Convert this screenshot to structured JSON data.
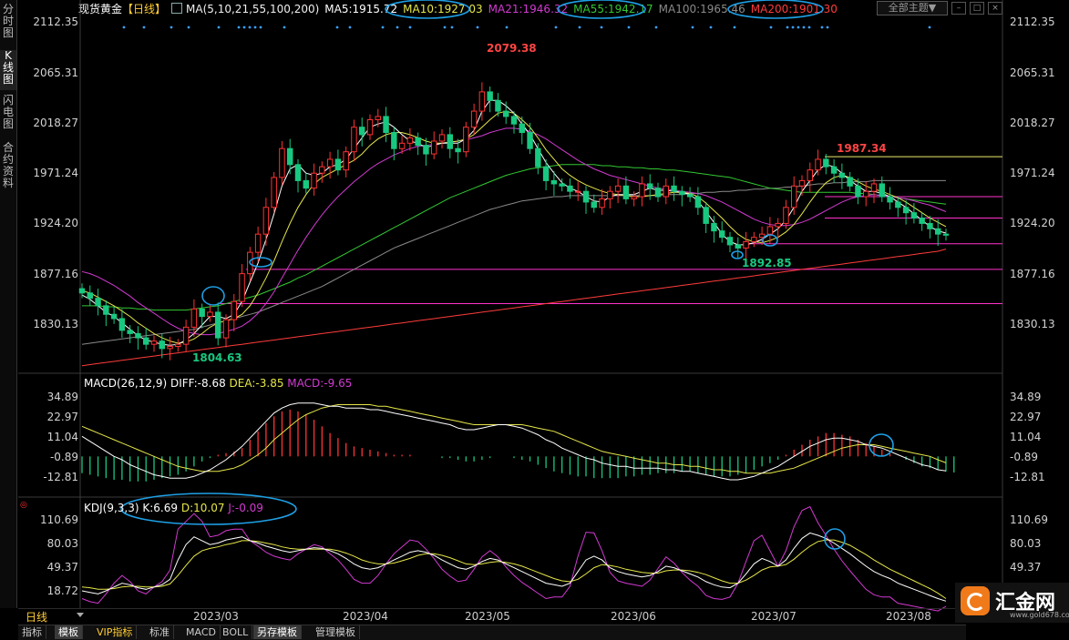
{
  "side_tabs": [
    {
      "label": "分时图",
      "active": false
    },
    {
      "label": "K线图",
      "active": true
    },
    {
      "label": "闪电图",
      "active": false
    },
    {
      "label": "合约资料",
      "active": false
    }
  ],
  "header": {
    "instrument": "现货黄金",
    "period": "【日线】",
    "ma_params": "MA(5,10,21,55,100,200)",
    "ma5": "MA5:1915.72",
    "ma10": "MA10:1927.03",
    "ma21": "MA21:1946.32",
    "ma55": "MA55:1942.17",
    "ma100": "MA100:1965.46",
    "ma200": "MA200:1901.30",
    "theme_label": "全部主题▼"
  },
  "colors": {
    "up": "#ff3232",
    "down": "#19c880",
    "ma5": "#ffffff",
    "ma10": "#e6e64a",
    "ma21": "#d23ad2",
    "ma55": "#32c832",
    "ma100": "#8a8a8a",
    "ma200": "#ff3b3b",
    "hline_pink": "#ff33cc",
    "hline_yellow": "#eded6a",
    "circle": "#1ea0e6"
  },
  "price_axis": [
    "2112.35",
    "2065.31",
    "2018.27",
    "1971.24",
    "1924.20",
    "1877.16",
    "1830.13"
  ],
  "annotations": {
    "high": "2079.38",
    "low": "1804.63",
    "recent_high": "1987.34",
    "recent_low": "1892.85"
  },
  "macd": {
    "header": "MACD(26,12,9)",
    "diff": "DIFF:-8.68",
    "dea": "DEA:-3.85",
    "macd": "MACD:-9.65",
    "axis": [
      "34.89",
      "22.97",
      "11.04",
      "-0.89",
      "-12.81"
    ]
  },
  "kdj": {
    "header": "KDJ(9,3,3)",
    "k": "K:6.69",
    "d": "D:10.07",
    "j": "J:-0.09",
    "axis": [
      "110.69",
      "80.03",
      "49.37",
      "18.72"
    ]
  },
  "dates": [
    "2023/03",
    "2023/04",
    "2023/05",
    "2023/06",
    "2023/07",
    "2023/08"
  ],
  "period_label": "日线",
  "bottom_tabs": [
    {
      "label": "指标",
      "active": false
    },
    {
      "label": "模板",
      "active": true
    },
    {
      "label": "VIP指标",
      "active": false
    },
    {
      "label": "标准",
      "active": false
    },
    {
      "label": "MACD",
      "active": false
    },
    {
      "label": "BOLL",
      "active": false
    },
    {
      "label": "另存模板",
      "active": true
    },
    {
      "label": "管理模板",
      "active": false
    }
  ],
  "logo": {
    "text": "汇金网",
    "url": "www.gold678.com"
  },
  "chart_data": {
    "type": "candlestick",
    "x_labels": [
      "2023/03",
      "2023/04",
      "2023/05",
      "2023/06",
      "2023/07",
      "2023/08"
    ],
    "y_ticks": [
      2112.35,
      2065.31,
      2018.27,
      1971.24,
      1924.2,
      1877.16,
      1830.13
    ],
    "ylim": [
      1790,
      2122
    ],
    "close": [
      1860,
      1855,
      1848,
      1840,
      1836,
      1825,
      1822,
      1818,
      1812,
      1815,
      1808,
      1810,
      1812,
      1828,
      1845,
      1838,
      1842,
      1818,
      1835,
      1852,
      1878,
      1898,
      1915,
      1940,
      1968,
      1995,
      1980,
      1965,
      1958,
      1972,
      1978,
      1985,
      1975,
      1992,
      2015,
      2008,
      2022,
      2025,
      2010,
      1995,
      2000,
      2005,
      1998,
      1990,
      2002,
      2008,
      1995,
      1992,
      2015,
      2030,
      2048,
      2040,
      2030,
      2025,
      2018,
      2010,
      1995,
      1978,
      1965,
      1962,
      1960,
      1955,
      1955,
      1945,
      1940,
      1948,
      1955,
      1960,
      1948,
      1950,
      1962,
      1958,
      1950,
      1960,
      1955,
      1952,
      1950,
      1940,
      1925,
      1918,
      1912,
      1905,
      1902,
      1908,
      1912,
      1915,
      1922,
      1925,
      1940,
      1960,
      1965,
      1975,
      1985,
      1978,
      1972,
      1968,
      1960,
      1950,
      1955,
      1962,
      1950,
      1945,
      1940,
      1935,
      1930,
      1925,
      1920,
      1915,
      1914
    ],
    "ma5": [
      1858,
      1854,
      1848,
      1842,
      1838,
      1832,
      1826,
      1820,
      1816,
      1814,
      1812,
      1811,
      1812,
      1816,
      1822,
      1830,
      1838,
      1838,
      1836,
      1840,
      1852,
      1870,
      1888,
      1910,
      1934,
      1960,
      1976,
      1980,
      1972,
      1970,
      1972,
      1978,
      1980,
      1985,
      1995,
      2005,
      2015,
      2018,
      2020,
      2015,
      2008,
      2002,
      2000,
      1996,
      1998,
      2000,
      2000,
      2000,
      2004,
      2012,
      2030,
      2040,
      2040,
      2035,
      2028,
      2018,
      2008,
      1995,
      1982,
      1972,
      1963,
      1958,
      1955,
      1950,
      1946,
      1945,
      1950,
      1952,
      1952,
      1952,
      1955,
      1958,
      1956,
      1956,
      1955,
      1954,
      1952,
      1946,
      1936,
      1926,
      1915,
      1908,
      1905,
      1905,
      1907,
      1910,
      1915,
      1920,
      1928,
      1940,
      1955,
      1965,
      1975,
      1980,
      1978,
      1972,
      1965,
      1960,
      1955,
      1955,
      1953,
      1950,
      1945,
      1940,
      1934,
      1928,
      1922,
      1918,
      1916
    ],
    "ma10": [
      1862,
      1860,
      1856,
      1852,
      1848,
      1843,
      1838,
      1832,
      1827,
      1822,
      1818,
      1815,
      1813,
      1814,
      1817,
      1822,
      1828,
      1832,
      1834,
      1836,
      1840,
      1848,
      1860,
      1874,
      1890,
      1908,
      1925,
      1940,
      1952,
      1962,
      1968,
      1972,
      1976,
      1980,
      1984,
      1990,
      1998,
      2004,
      2008,
      2010,
      2010,
      2008,
      2005,
      2002,
      2000,
      2000,
      2001,
      2002,
      2004,
      2008,
      2015,
      2022,
      2028,
      2030,
      2028,
      2022,
      2015,
      2005,
      1994,
      1985,
      1976,
      1970,
      1965,
      1961,
      1958,
      1955,
      1953,
      1952,
      1951,
      1950,
      1950,
      1951,
      1952,
      1953,
      1954,
      1954,
      1953,
      1950,
      1944,
      1937,
      1930,
      1922,
      1915,
      1910,
      1908,
      1907,
      1909,
      1912,
      1917,
      1924,
      1934,
      1945,
      1955,
      1963,
      1968,
      1970,
      1968,
      1964,
      1960,
      1957,
      1955,
      1952,
      1949,
      1945,
      1940,
      1935,
      1930,
      1926,
      1922
    ],
    "ma21": [
      1880,
      1878,
      1875,
      1871,
      1867,
      1862,
      1857,
      1851,
      1846,
      1841,
      1836,
      1831,
      1827,
      1824,
      1822,
      1821,
      1821,
      1822,
      1824,
      1826,
      1829,
      1834,
      1841,
      1850,
      1861,
      1874,
      1887,
      1900,
      1912,
      1923,
      1933,
      1942,
      1950,
      1957,
      1964,
      1970,
      1976,
      1981,
      1985,
      1989,
      1992,
      1995,
      1997,
      1998,
      1999,
      2000,
      2001,
      2002,
      2003,
      2005,
      2007,
      2010,
      2012,
      2014,
      2014,
      2013,
      2011,
      2008,
      2004,
      1999,
      1994,
      1989,
      1984,
      1980,
      1976,
      1973,
      1970,
      1968,
      1966,
      1964,
      1962,
      1960,
      1958,
      1957,
      1956,
      1955,
      1954,
      1953,
      1951,
      1948,
      1945,
      1941,
      1937,
      1933,
      1929,
      1926,
      1924,
      1923,
      1923,
      1924,
      1926,
      1929,
      1933,
      1937,
      1941,
      1945,
      1948,
      1950,
      1951,
      1952,
      1951,
      1950,
      1949,
      1948,
      1946,
      1944,
      1942,
      1939,
      1936
    ],
    "ma55": [
      1848,
      1848,
      1848,
      1847,
      1847,
      1846,
      1846,
      1845,
      1845,
      1844,
      1844,
      1844,
      1844,
      1844,
      1845,
      1846,
      1847,
      1848,
      1850,
      1852,
      1854,
      1856,
      1858,
      1861,
      1864,
      1867,
      1870,
      1874,
      1877,
      1881,
      1885,
      1889,
      1893,
      1897,
      1901,
      1905,
      1909,
      1913,
      1917,
      1921,
      1925,
      1929,
      1933,
      1937,
      1941,
      1945,
      1949,
      1952,
      1955,
      1958,
      1961,
      1964,
      1967,
      1970,
      1972,
      1974,
      1976,
      1977,
      1978,
      1979,
      1980,
      1980,
      1980,
      1980,
      1980,
      1979,
      1979,
      1978,
      1978,
      1977,
      1977,
      1976,
      1976,
      1975,
      1975,
      1974,
      1973,
      1972,
      1971,
      1970,
      1969,
      1968,
      1966,
      1964,
      1962,
      1960,
      1958,
      1957,
      1956,
      1955,
      1954,
      1954,
      1954,
      1954,
      1954,
      1954,
      1954,
      1953,
      1953,
      1952,
      1951,
      1950,
      1949,
      1948,
      1947,
      1946,
      1945,
      1944,
      1943
    ],
    "ma100": [
      1812,
      1813,
      1814,
      1815,
      1816,
      1817,
      1818,
      1819,
      1820,
      1821,
      1822,
      1823,
      1824,
      1825,
      1826,
      1828,
      1830,
      1832,
      1834,
      1836,
      1838,
      1840,
      1842,
      1845,
      1848,
      1851,
      1854,
      1857,
      1860,
      1863,
      1866,
      1870,
      1874,
      1878,
      1882,
      1886,
      1890,
      1894,
      1898,
      1902,
      1905,
      1908,
      1911,
      1914,
      1917,
      1920,
      1923,
      1926,
      1929,
      1932,
      1935,
      1938,
      1940,
      1942,
      1944,
      1946,
      1947,
      1948,
      1949,
      1950,
      1950,
      1951,
      1951,
      1951,
      1951,
      1951,
      1951,
      1951,
      1951,
      1951,
      1951,
      1951,
      1951,
      1952,
      1952,
      1952,
      1953,
      1953,
      1954,
      1954,
      1955,
      1955,
      1956,
      1956,
      1957,
      1957,
      1958,
      1958,
      1959,
      1959,
      1960,
      1961,
      1962,
      1962,
      1963,
      1963,
      1964,
      1964,
      1964,
      1965,
      1965,
      1965,
      1965,
      1965,
      1965,
      1965,
      1965,
      1965,
      1965
    ],
    "ma200": [
      1792,
      1793,
      1794,
      1795,
      1796,
      1797,
      1798,
      1799,
      1800,
      1801,
      1802,
      1803,
      1804,
      1805,
      1806,
      1807,
      1808,
      1809,
      1810,
      1811,
      1812,
      1813,
      1814,
      1815,
      1816,
      1817,
      1818,
      1819,
      1820,
      1821,
      1822,
      1823,
      1824,
      1825,
      1826,
      1827,
      1828,
      1829,
      1830,
      1831,
      1832,
      1833,
      1834,
      1835,
      1836,
      1837,
      1838,
      1839,
      1840,
      1841,
      1842,
      1843,
      1844,
      1845,
      1846,
      1847,
      1848,
      1849,
      1850,
      1851,
      1852,
      1853,
      1854,
      1855,
      1856,
      1857,
      1858,
      1859,
      1860,
      1861,
      1862,
      1863,
      1864,
      1865,
      1866,
      1867,
      1868,
      1869,
      1870,
      1871,
      1872,
      1873,
      1874,
      1875,
      1876,
      1877,
      1878,
      1879,
      1880,
      1881,
      1882,
      1883,
      1884,
      1885,
      1886,
      1887,
      1888,
      1889,
      1890,
      1891,
      1892,
      1893,
      1894,
      1895,
      1896,
      1897,
      1898,
      1899,
      1901
    ],
    "hlines": [
      1987.34,
      1950,
      1930,
      1906,
      1882,
      1850
    ],
    "macd_ylim": [
      -20,
      40
    ],
    "macd_ticks": [
      34.89,
      22.97,
      11.04,
      -0.89,
      -12.81
    ],
    "macd_hist": [
      -10,
      -11,
      -12,
      -13,
      -14,
      -14,
      -15,
      -15,
      -15,
      -14,
      -13,
      -12,
      -11,
      -9,
      -6,
      -3,
      -1,
      1,
      2,
      3,
      5,
      10,
      15,
      20,
      24,
      27,
      28,
      27,
      25,
      22,
      18,
      14,
      11,
      8,
      6,
      5,
      4,
      3,
      2,
      1,
      1,
      1,
      0,
      0,
      0,
      -1,
      -1,
      -2,
      -3,
      -3,
      -2,
      -1,
      0,
      0,
      -1,
      -2,
      -3,
      -5,
      -7,
      -9,
      -10,
      -11,
      -12,
      -12,
      -13,
      -13,
      -13,
      -13,
      -12,
      -12,
      -11,
      -11,
      -10,
      -10,
      -10,
      -9,
      -9,
      -10,
      -11,
      -12,
      -12,
      -12,
      -11,
      -10,
      -8,
      -6,
      -4,
      -2,
      1,
      4,
      7,
      10,
      12,
      14,
      14,
      13,
      12,
      10,
      8,
      6,
      4,
      2,
      0,
      -2,
      -4,
      -6,
      -7,
      -8,
      -9,
      -9.65
    ],
    "macd_diff": [
      12,
      9,
      6,
      3,
      0,
      -2,
      -5,
      -7,
      -9,
      -11,
      -12,
      -13,
      -13,
      -13,
      -12,
      -10,
      -8,
      -5,
      -2,
      2,
      6,
      11,
      16,
      21,
      26,
      29,
      31,
      32,
      32,
      32,
      31,
      30,
      30,
      29,
      29,
      29,
      28,
      28,
      27,
      26,
      25,
      24,
      23,
      22,
      21,
      20,
      19,
      17,
      16,
      16,
      17,
      18,
      19,
      19,
      18,
      17,
      15,
      13,
      10,
      8,
      5,
      3,
      1,
      -1,
      -2,
      -4,
      -5,
      -6,
      -6,
      -7,
      -7,
      -7,
      -7,
      -8,
      -8,
      -9,
      -9,
      -10,
      -11,
      -12,
      -13,
      -14,
      -14,
      -13,
      -12,
      -10,
      -8,
      -6,
      -3,
      0,
      3,
      6,
      8,
      10,
      11,
      11,
      10,
      9,
      7,
      6,
      5,
      3,
      1,
      -1,
      -3,
      -5,
      -6,
      -8,
      -8.68
    ],
    "macd_dea": [
      18,
      16,
      14,
      12,
      10,
      8,
      6,
      4,
      2,
      0,
      -2,
      -4,
      -6,
      -7,
      -8,
      -9,
      -9,
      -9,
      -8,
      -7,
      -5,
      -2,
      1,
      5,
      10,
      14,
      18,
      22,
      25,
      27,
      29,
      30,
      31,
      31,
      31,
      31,
      31,
      30,
      30,
      29,
      28,
      27,
      26,
      25,
      24,
      23,
      22,
      21,
      20,
      19,
      19,
      19,
      19,
      19,
      19,
      19,
      18,
      17,
      16,
      15,
      13,
      11,
      9,
      7,
      5,
      3,
      2,
      1,
      0,
      -1,
      -2,
      -3,
      -4,
      -4,
      -5,
      -5,
      -6,
      -6,
      -7,
      -8,
      -8,
      -9,
      -9,
      -10,
      -10,
      -10,
      -10,
      -9,
      -8,
      -7,
      -5,
      -3,
      -1,
      1,
      3,
      5,
      6,
      7,
      7,
      7,
      6,
      5,
      4,
      3,
      2,
      1,
      0,
      -2,
      -3.85
    ],
    "kdj_ylim": [
      0,
      125
    ],
    "kdj_ticks": [
      110.69,
      80.03,
      49.37,
      18.72
    ],
    "kdj_k": [
      20,
      18,
      16,
      20,
      25,
      30,
      28,
      24,
      22,
      25,
      28,
      35,
      60,
      80,
      90,
      85,
      80,
      82,
      86,
      88,
      90,
      85,
      82,
      78,
      75,
      72,
      70,
      72,
      74,
      76,
      75,
      72,
      68,
      62,
      55,
      50,
      48,
      50,
      55,
      60,
      65,
      70,
      72,
      70,
      66,
      60,
      55,
      50,
      48,
      52,
      58,
      62,
      60,
      55,
      50,
      45,
      40,
      35,
      30,
      28,
      26,
      30,
      45,
      60,
      65,
      60,
      50,
      45,
      42,
      40,
      38,
      40,
      45,
      52,
      50,
      46,
      42,
      38,
      32,
      28,
      25,
      24,
      30,
      42,
      55,
      62,
      58,
      52,
      60,
      75,
      88,
      95,
      92,
      88,
      82,
      75,
      68,
      60,
      52,
      45,
      40,
      36,
      30,
      26,
      22,
      18,
      14,
      10,
      6.69
    ],
    "kdj_d": [
      25,
      24,
      22,
      22,
      23,
      25,
      26,
      26,
      25,
      25,
      26,
      29,
      40,
      53,
      65,
      72,
      75,
      77,
      80,
      82,
      85,
      85,
      84,
      82,
      80,
      77,
      75,
      74,
      74,
      74,
      74,
      74,
      72,
      69,
      65,
      60,
      57,
      55,
      55,
      56,
      59,
      62,
      66,
      68,
      68,
      66,
      63,
      59,
      55,
      54,
      55,
      57,
      58,
      57,
      55,
      52,
      48,
      44,
      40,
      36,
      33,
      32,
      35,
      42,
      50,
      54,
      53,
      51,
      48,
      46,
      44,
      43,
      43,
      46,
      47,
      47,
      46,
      44,
      41,
      37,
      33,
      30,
      30,
      34,
      40,
      47,
      51,
      52,
      54,
      61,
      70,
      78,
      84,
      86,
      86,
      83,
      79,
      73,
      67,
      60,
      54,
      48,
      43,
      38,
      33,
      28,
      23,
      17,
      10.07
    ],
    "kdj_j": [
      10,
      6,
      4,
      16,
      30,
      40,
      32,
      20,
      16,
      25,
      32,
      47,
      100,
      110,
      120,
      110,
      90,
      92,
      98,
      100,
      100,
      85,
      78,
      70,
      65,
      62,
      60,
      68,
      74,
      80,
      77,
      68,
      60,
      48,
      35,
      30,
      30,
      40,
      55,
      68,
      77,
      86,
      84,
      74,
      62,
      48,
      39,
      32,
      34,
      48,
      64,
      72,
      64,
      51,
      40,
      31,
      24,
      17,
      10,
      12,
      12,
      26,
      65,
      96,
      95,
      72,
      44,
      33,
      30,
      28,
      26,
      34,
      49,
      64,
      56,
      44,
      34,
      26,
      14,
      10,
      9,
      12,
      30,
      58,
      85,
      92,
      72,
      52,
      72,
      103,
      124,
      129,
      108,
      92,
      74,
      59,
      46,
      34,
      22,
      15,
      12,
      12,
      4,
      2,
      0,
      -2,
      -4,
      -6,
      -0.09
    ]
  }
}
